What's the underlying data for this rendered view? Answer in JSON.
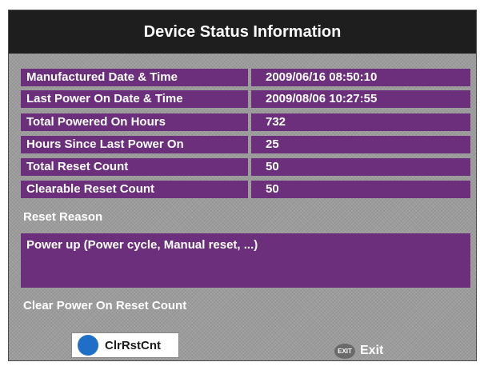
{
  "title": "Device Status Information",
  "rows": [
    {
      "label": "Manufactured Date & Time",
      "value": "2009/06/16 08:50:10"
    },
    {
      "label": "Last Power On Date & Time",
      "value": "2009/08/06 10:27:55"
    },
    {
      "label": "Total Powered On Hours",
      "value": "732"
    },
    {
      "label": "Hours Since Last Power On",
      "value": "25"
    },
    {
      "label": "Total Reset Count",
      "value": "50"
    },
    {
      "label": "Clearable Reset Count",
      "value": "50"
    }
  ],
  "reset_reason": {
    "label": "Reset Reason",
    "value": "Power up (Power cycle, Manual reset, ...)"
  },
  "clear_section_label": "Clear Power On Reset Count",
  "buttons": {
    "clear": {
      "label": "ClrRstCnt",
      "icon": "blue-circle-icon",
      "color": "#1f6fc8"
    },
    "exit": {
      "icon_text": "EXIT",
      "label": "Exit"
    }
  },
  "colors": {
    "title_bar": "#1e1e1e",
    "row_fill": "#6b2f7c",
    "background": "#9c9c9c"
  }
}
